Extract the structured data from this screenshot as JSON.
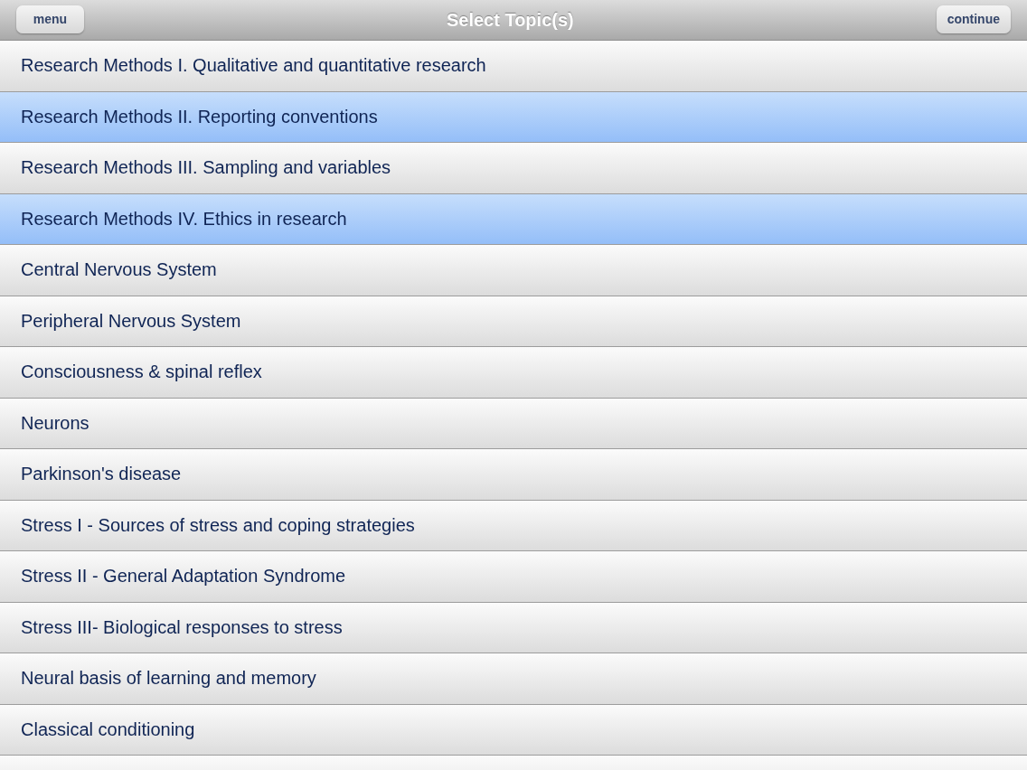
{
  "nav_bar": {
    "title": "Select Topic(s)",
    "left_button": "menu",
    "right_button": "continue"
  },
  "topics": [
    {
      "label": "Research Methods I. Qualitative and quantitative research",
      "selected": false
    },
    {
      "label": "Research Methods II. Reporting conventions",
      "selected": true
    },
    {
      "label": "Research Methods III. Sampling and variables",
      "selected": false
    },
    {
      "label": "Research Methods IV. Ethics in research",
      "selected": true
    },
    {
      "label": "Central Nervous System",
      "selected": false
    },
    {
      "label": "Peripheral Nervous System",
      "selected": false
    },
    {
      "label": "Consciousness & spinal reflex",
      "selected": false
    },
    {
      "label": "Neurons",
      "selected": false
    },
    {
      "label": "Parkinson's disease",
      "selected": false
    },
    {
      "label": "Stress I - Sources of stress and coping strategies",
      "selected": false
    },
    {
      "label": "Stress II - General Adaptation Syndrome",
      "selected": false
    },
    {
      "label": "Stress III- Biological responses to stress",
      "selected": false
    },
    {
      "label": "Neural basis of learning and memory",
      "selected": false
    },
    {
      "label": "Classical conditioning",
      "selected": false
    }
  ]
}
